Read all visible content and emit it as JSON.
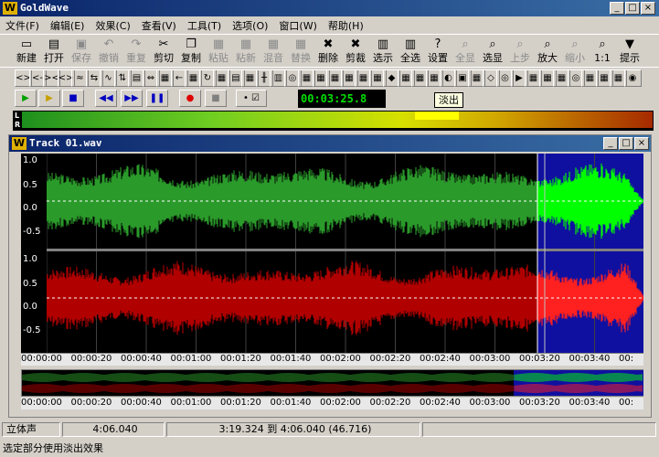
{
  "app": {
    "title": "GoldWave",
    "logo": "W"
  },
  "window_buttons": [
    "_",
    "□",
    "×"
  ],
  "menu": [
    "文件(F)",
    "编辑(E)",
    "效果(C)",
    "查看(V)",
    "工具(T)",
    "选项(O)",
    "窗口(W)",
    "帮助(H)"
  ],
  "toolbar1": [
    {
      "label": "新建",
      "icon": "new-icon",
      "glyph": "▭",
      "enabled": true
    },
    {
      "label": "打开",
      "icon": "open-icon",
      "glyph": "▤",
      "enabled": true
    },
    {
      "label": "保存",
      "icon": "save-icon",
      "glyph": "▣",
      "enabled": false
    },
    {
      "label": "撤销",
      "icon": "undo-icon",
      "glyph": "↶",
      "enabled": false
    },
    {
      "label": "重复",
      "icon": "redo-icon",
      "glyph": "↷",
      "enabled": false
    },
    {
      "label": "剪切",
      "icon": "cut-icon",
      "glyph": "✂",
      "enabled": true
    },
    {
      "label": "复制",
      "icon": "copy-icon",
      "glyph": "❐",
      "enabled": true
    },
    {
      "label": "粘贴",
      "icon": "paste-icon",
      "glyph": "▦",
      "enabled": false
    },
    {
      "label": "粘新",
      "icon": "paste-new-icon",
      "glyph": "▦",
      "enabled": false
    },
    {
      "label": "混音",
      "icon": "mix-icon",
      "glyph": "▦",
      "enabled": false
    },
    {
      "label": "替换",
      "icon": "replace-icon",
      "glyph": "▦",
      "enabled": false
    },
    {
      "label": "删除",
      "icon": "delete-icon",
      "glyph": "✖",
      "enabled": true
    },
    {
      "label": "剪裁",
      "icon": "trim-icon",
      "glyph": "✖",
      "enabled": true
    },
    {
      "label": "选示",
      "icon": "select-view-icon",
      "glyph": "▥",
      "enabled": true
    },
    {
      "label": "全选",
      "icon": "select-all-icon",
      "glyph": "▥",
      "enabled": true
    },
    {
      "label": "设置",
      "icon": "settings-icon",
      "glyph": "?",
      "enabled": true
    },
    {
      "label": "全显",
      "icon": "show-all-icon",
      "glyph": "⌕",
      "enabled": false
    },
    {
      "label": "选显",
      "icon": "zoom-selection-icon",
      "glyph": "⌕",
      "enabled": true
    },
    {
      "label": "上步",
      "icon": "previous-icon",
      "glyph": "⌕",
      "enabled": false
    },
    {
      "label": "放大",
      "icon": "zoom-in-icon",
      "glyph": "⌕",
      "enabled": true
    },
    {
      "label": "缩小",
      "icon": "zoom-out-icon",
      "glyph": "⌕",
      "enabled": false
    },
    {
      "label": "1:1",
      "icon": "zoom-1to1-icon",
      "glyph": "⌕",
      "enabled": true
    },
    {
      "label": "提示",
      "icon": "hint-icon",
      "glyph": "▼",
      "enabled": true
    }
  ],
  "toolbar2_glyphs": [
    "<>",
    "<-",
    "><",
    "<>",
    "≈",
    "⇆",
    "∿",
    "⇅",
    "▤",
    "⇔",
    "▦",
    "←",
    "▦",
    "↻",
    "▦",
    "▤",
    "▦",
    "╫",
    "▥",
    "◎",
    "▦",
    "▦",
    "▦",
    "▦",
    "▦",
    "▦",
    "◆",
    "▦",
    "▦",
    "▦",
    "◐",
    "▣",
    "▦",
    "◇",
    "◎",
    "▶",
    "▦",
    "▦",
    "▦",
    "◎",
    "▦",
    "▦",
    "▦",
    "◉"
  ],
  "transport": {
    "play": "▶",
    "play_sel": "▶",
    "stop": "■",
    "rewind": "◀◀",
    "ffwd": "▶▶",
    "pause": "❚❚",
    "record": "●",
    "record_stop": "■",
    "checks": "• ☑"
  },
  "timecode": "00:03:25.8",
  "tooltip": "淡出",
  "levels": {
    "l": "L",
    "r": "R"
  },
  "track": {
    "title": "Track 01.wav",
    "y_labels": [
      "1.0",
      "0.5",
      "0.0",
      "-0.5",
      "1.0",
      "0.5",
      "0.0",
      "-0.5"
    ],
    "ruler": [
      "00:00:00",
      "00:00:20",
      "00:00:40",
      "00:01:00",
      "00:01:20",
      "00:01:40",
      "00:02:00",
      "00:02:20",
      "00:02:40",
      "00:03:00",
      "00:03:20",
      "00:03:40",
      "00:"
    ]
  },
  "colors": {
    "left_wave": "#2a9a2a",
    "right_wave": "#b00000",
    "left_sel": "#00ff00",
    "right_sel": "#ff2020",
    "selection_bg": "#1010a0"
  },
  "status": {
    "mode": "立体声",
    "length": "4:06.040",
    "range": "3:19.324 到 4:06.040 (46.716)",
    "hint": "选定部分使用淡出效果"
  }
}
